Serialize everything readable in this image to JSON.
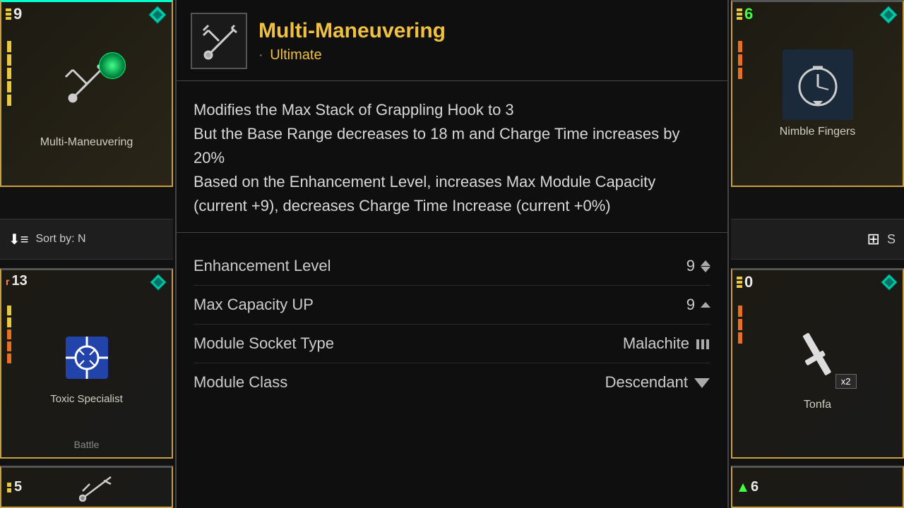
{
  "leftCard": {
    "rank": "9",
    "rankBars": 3,
    "name": "Multi-\nManeuvering",
    "nameLabel": "Multi-Maneuvering"
  },
  "rightCard": {
    "rank": "6",
    "name": "Nimble Fingers"
  },
  "sortBar": {
    "label": "Sort by: N"
  },
  "bottomLeftCard": {
    "rank": "13",
    "rankPrefix": "r",
    "name": "Toxic Specialist",
    "tag": "Battle"
  },
  "bottomRightCard": {
    "rank": "0",
    "name": "Tonfa",
    "badge": "x2"
  },
  "detail": {
    "skillName": "Multi-Maneuvering",
    "skillType": "Ultimate",
    "description": "Modifies the Max Stack of Grappling Hook to 3\nBut the Base Range decreases to 18 m and Charge Time increases by 20%\nBased on the Enhancement Level, increases Max Module Capacity (current +9), decreases Charge Time Increase (current +0%)",
    "stats": [
      {
        "label": "Enhancement Level",
        "value": "9",
        "control": "updown"
      },
      {
        "label": "Max Capacity UP",
        "value": "9",
        "control": "up"
      },
      {
        "label": "Module Socket Type",
        "value": "Malachite",
        "control": "malachite"
      },
      {
        "label": "Module Class",
        "value": "Descendant",
        "control": "descendant"
      }
    ]
  },
  "bottomPartialLeft": {
    "rank": "5"
  },
  "bottomPartialRight": {
    "rank": "6"
  }
}
